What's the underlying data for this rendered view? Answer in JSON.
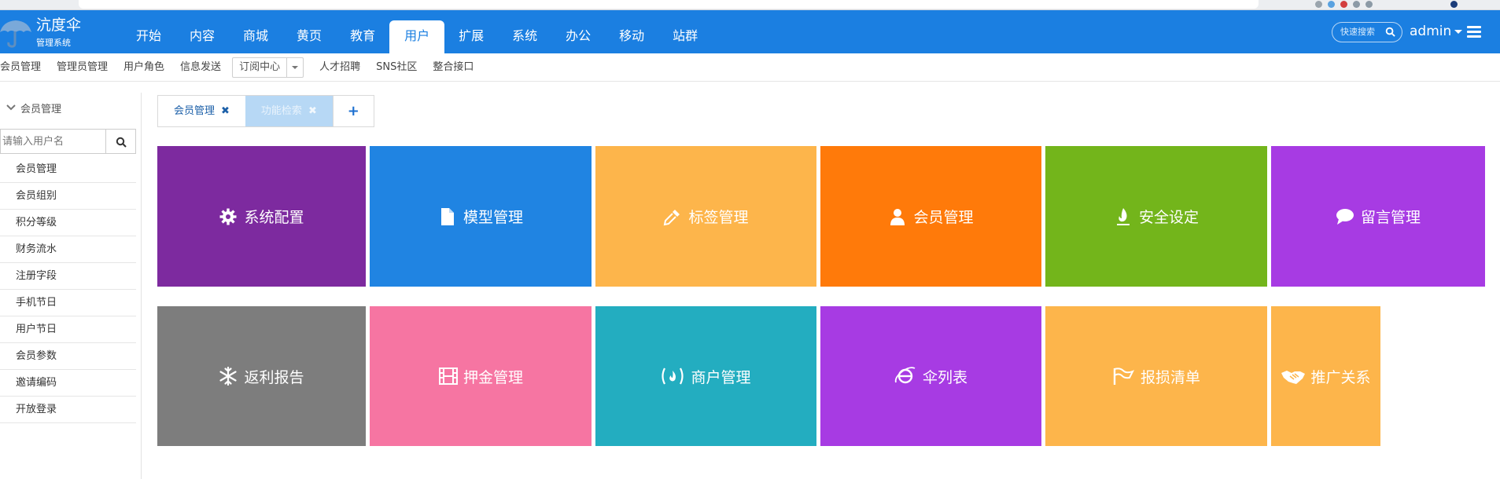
{
  "header": {
    "brand": "沆度伞",
    "brand_sub": "管理系统",
    "nav": [
      "开始",
      "内容",
      "商城",
      "黄页",
      "教育",
      "用户",
      "扩展",
      "系统",
      "办公",
      "移动",
      "站群"
    ],
    "active_nav": "用户",
    "search_placeholder": "快速搜索",
    "user": "admin"
  },
  "subnav": {
    "items_before": [
      "会员管理",
      "管理员管理",
      "用户角色",
      "信息发送"
    ],
    "dropdown_label": "订阅中心",
    "items_after": [
      "人才招聘",
      "SNS社区",
      "整合接口"
    ]
  },
  "sidebar": {
    "heading": "会员管理",
    "search_placeholder": "请输入用户名",
    "items": [
      "会员管理",
      "会员组别",
      "积分等级",
      "财务流水",
      "注册字段",
      "手机节日",
      "用户节日",
      "会员参数",
      "邀请编码",
      "开放登录"
    ]
  },
  "tabs": {
    "items": [
      "会员管理",
      "功能检索"
    ],
    "close_glyph": "✖",
    "add_glyph": "+"
  },
  "tiles": [
    {
      "label": "系统配置",
      "icon": "gear-icon",
      "color": "#7d2a9f"
    },
    {
      "label": "模型管理",
      "icon": "file-icon",
      "color": "#2084e2"
    },
    {
      "label": "标签管理",
      "icon": "eyedropper-icon",
      "color": "#fdb54b"
    },
    {
      "label": "会员管理",
      "icon": "user-icon",
      "color": "#ff7a0a"
    },
    {
      "label": "安全设定",
      "icon": "fire-icon",
      "color": "#73b51b"
    },
    {
      "label": "留言管理",
      "icon": "comment-icon",
      "color": "#a73be3"
    },
    {
      "label": "返利报告",
      "icon": "snowflake-icon",
      "color": "#7d7d7d"
    },
    {
      "label": "押金管理",
      "icon": "film-icon",
      "color": "#f675a2"
    },
    {
      "label": "商户管理",
      "icon": "free-code-camp-icon",
      "color": "#23adc0"
    },
    {
      "label": "伞列表",
      "icon": "internet-explorer-icon",
      "color": "#a73be3"
    },
    {
      "label": "报损清单",
      "icon": "flag-icon",
      "color": "#fdb54b"
    },
    {
      "label": "推广关系",
      "icon": "handshake-icon",
      "color": "#fdb54b"
    }
  ],
  "colors": {
    "header_bg": "#1b7fe1",
    "accent": "#1b7fe1",
    "tab_inactive_bg": "#b7d8f5"
  }
}
